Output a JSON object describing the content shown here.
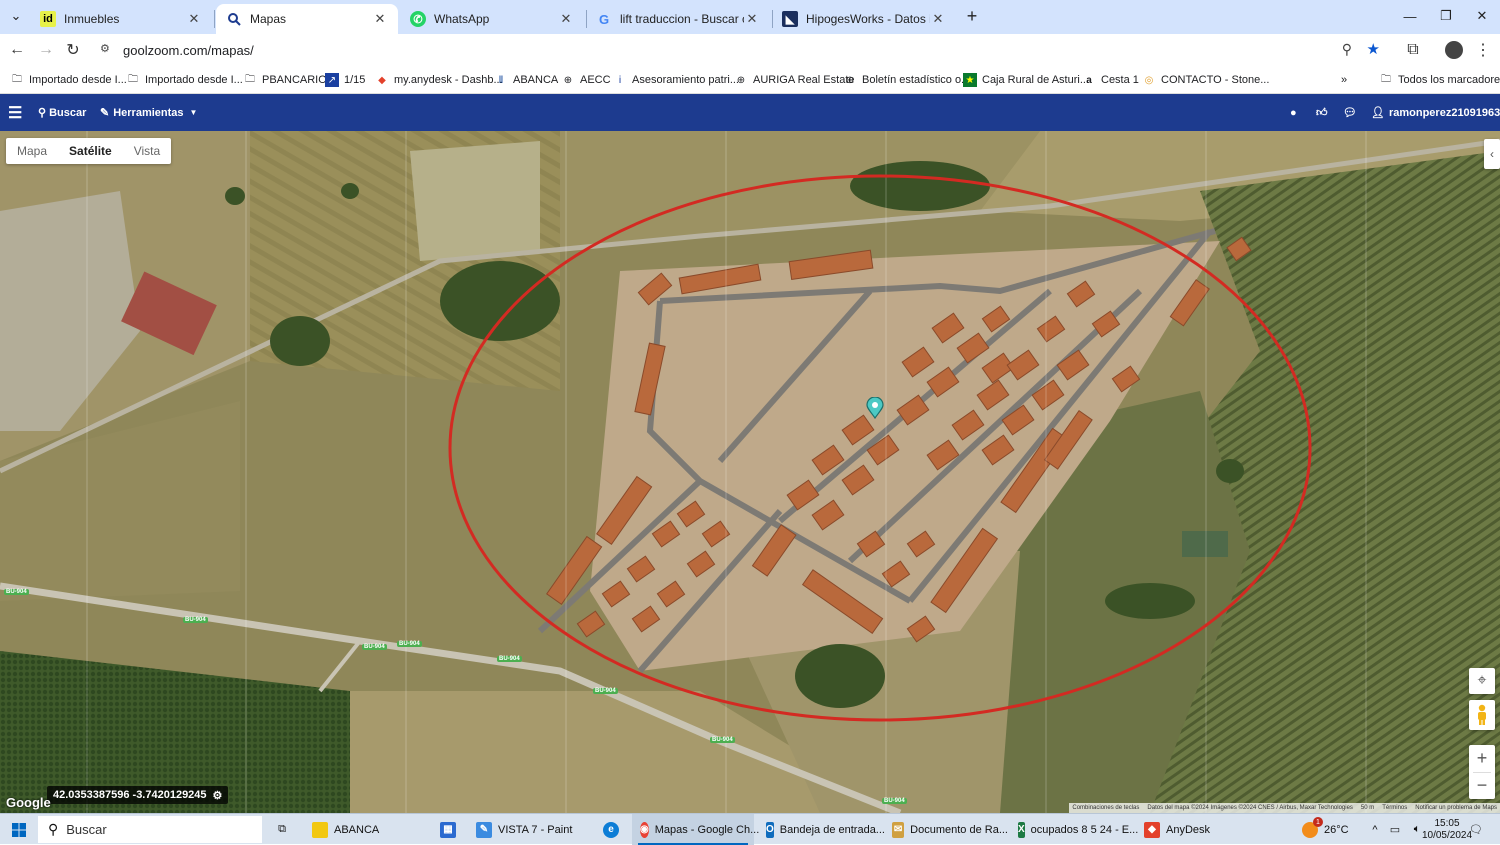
{
  "browser": {
    "tabs": [
      {
        "title": "Inmuebles",
        "icon": "idealista-icon"
      },
      {
        "title": "Mapas",
        "icon": "goolzoom-icon"
      },
      {
        "title": "WhatsApp",
        "icon": "whatsapp-icon"
      },
      {
        "title": "lift traduccion - Buscar con Goo",
        "icon": "google-icon"
      },
      {
        "title": "HipogesWorks - Datos inmueb",
        "icon": "hipoges-icon"
      }
    ],
    "address": "goolzoom.com/mapas/",
    "bookmarks": [
      "Importado desde I...",
      "Importado desde I...",
      "PBANCARIO",
      "1/15",
      "my.anydesk - Dashb...",
      "ABANCA",
      "AECC",
      "Asesoramiento patri...",
      "AURIGA Real Estate",
      "Boletín estadístico o...",
      "Caja Rural de Asturi...",
      "Cesta 1",
      "CONTACTO - Stone..."
    ],
    "all_bookmarks": "Todos los marcadores"
  },
  "app": {
    "search": "Buscar",
    "tools": "Herramientas",
    "user": "ramonperez21091963"
  },
  "map": {
    "types": [
      "Mapa",
      "Satélite",
      "Vista"
    ],
    "selected_type": "Satélite",
    "coordinates": "42.0353387596 -3.7420129245",
    "google": "Google",
    "road_labels": [
      "BU-904",
      "BU-904",
      "BU-904",
      "BU-904",
      "BU-904",
      "BU-904",
      "BU-904",
      "BU-904"
    ],
    "attribution": [
      "Combinaciones de teclas",
      "Datos del mapa ©2024 Imágenes ©2024 CNES / Airbus, Maxar Technologies",
      "50 m",
      "Términos",
      "Notificar un problema de Maps"
    ]
  },
  "taskbar": {
    "search": "Buscar",
    "apps": [
      {
        "label": "ABANCA",
        "color": "#f2c811"
      },
      {
        "label": "",
        "color": "#2b6ad0"
      },
      {
        "label": "VISTA 7 - Paint",
        "color": "#3b8be0"
      },
      {
        "label": "",
        "color": "#0c7dd6"
      },
      {
        "label": "Mapas - Google Ch...",
        "color": "#e94235"
      },
      {
        "label": "Bandeja de entrada...",
        "color": "#0f6cbd"
      },
      {
        "label": "Documento de Ra...",
        "color": "#d0a040"
      },
      {
        "label": "ocupados 8 5 24 - E...",
        "color": "#1d7a44"
      },
      {
        "label": "AnyDesk",
        "color": "#e3412b"
      }
    ],
    "weather": "26°C",
    "badge": "1",
    "time": "15:05",
    "date": "10/05/2024"
  }
}
